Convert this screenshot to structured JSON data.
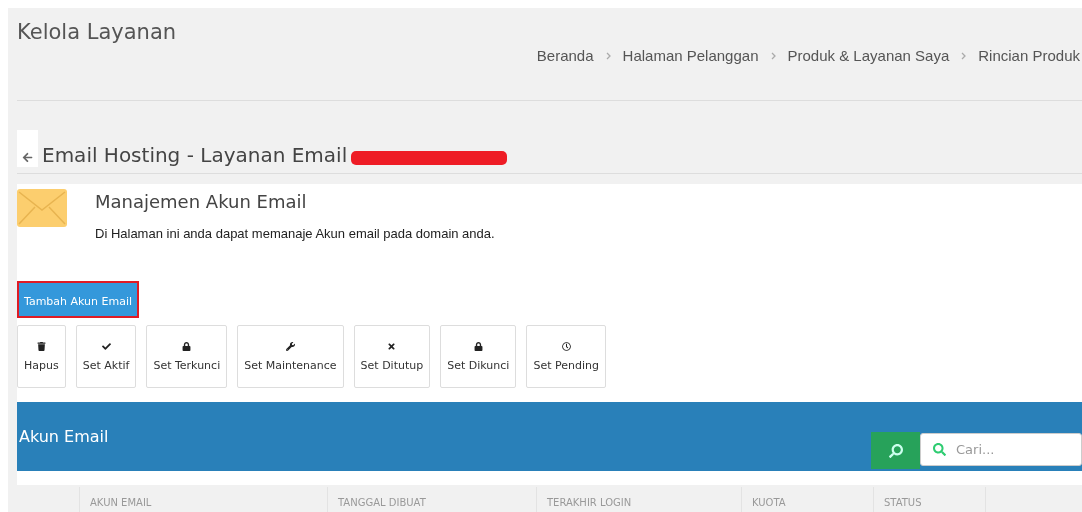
{
  "page_title": "Kelola Layanan",
  "breadcrumb": [
    "Beranda",
    "Halaman Pelanggan",
    "Produk & Layanan Saya",
    "Rincian Produk"
  ],
  "heading": "Email Hosting - Layanan Email",
  "intro": {
    "title": "Manajemen Akun Email",
    "description": "Di Halaman ini anda dapat memanaje Akun email pada domain anda."
  },
  "add_button": "Tambah Akun Email",
  "actions": [
    {
      "kind": "trash",
      "label": "Hapus"
    },
    {
      "kind": "check",
      "label": "Set Aktif"
    },
    {
      "kind": "lock",
      "label": "Set Terkunci"
    },
    {
      "kind": "wrench",
      "label": "Set Maintenance"
    },
    {
      "kind": "close",
      "label": "Set Ditutup"
    },
    {
      "kind": "lock",
      "label": "Set Dikunci"
    },
    {
      "kind": "clock",
      "label": "Set Pending"
    }
  ],
  "panel": {
    "title": "Akun Email",
    "search": {
      "placeholder": "Cari..."
    }
  },
  "table": {
    "columns": [
      "AKUN EMAIL",
      "TANGGAL DIBUAT",
      "TERAKHIR LOGIN",
      "KUOTA",
      "STATUS"
    ]
  }
}
